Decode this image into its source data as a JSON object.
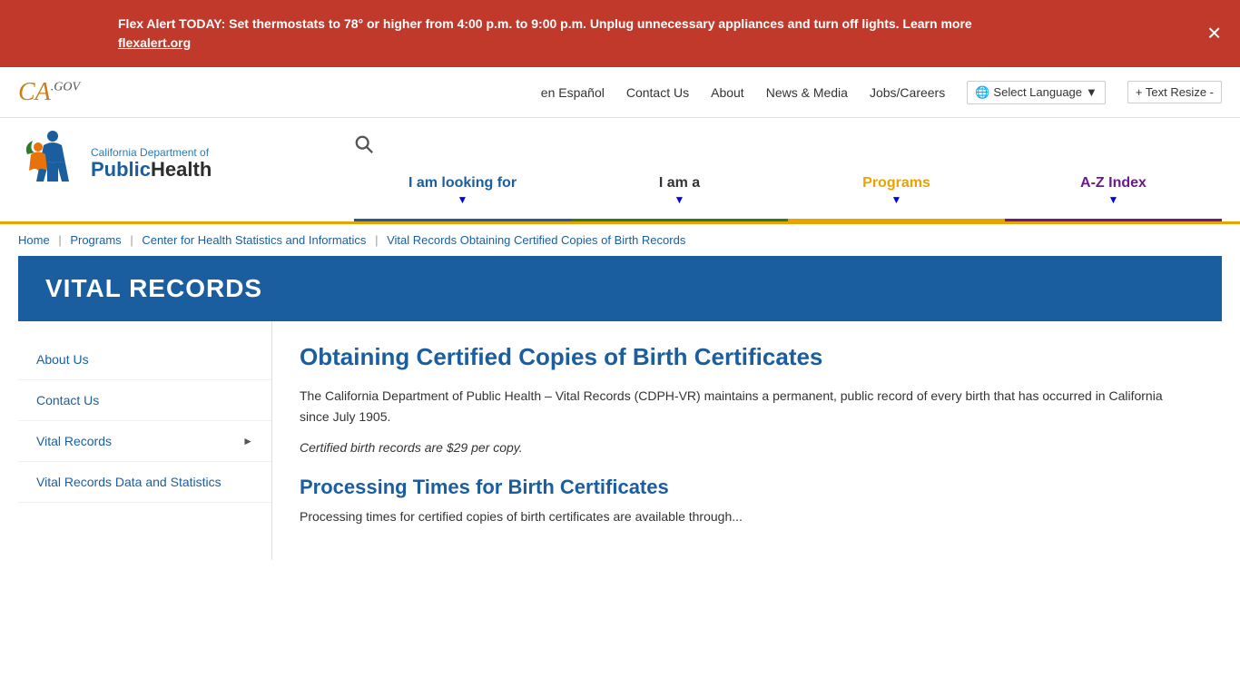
{
  "alert": {
    "text": "Flex Alert TODAY: Set thermostats to 78° or higher from 4:00 p.m. to 9:00 p.m. Unplug unnecessary appliances and turn off lights. Learn more",
    "link_text": "flexalert.org",
    "link_href": "#"
  },
  "topnav": {
    "logo": "CA",
    "logo_sup": ".GOV",
    "links": [
      {
        "label": "en Español",
        "href": "#"
      },
      {
        "label": "Contact Us",
        "href": "#"
      },
      {
        "label": "About",
        "href": "#"
      },
      {
        "label": "News & Media",
        "href": "#"
      },
      {
        "label": "Jobs/Careers",
        "href": "#"
      }
    ],
    "language_label": "Select Language",
    "text_resize_label": "+ Text Resize -"
  },
  "header": {
    "logo_line1": "California Department of",
    "logo_public": "Public",
    "logo_health": "Health",
    "nav_items": [
      {
        "label": "I am looking for",
        "style": "looking"
      },
      {
        "label": "I am a",
        "style": "iam"
      },
      {
        "label": "Programs",
        "style": "programs"
      },
      {
        "label": "A-Z Index",
        "style": "az"
      }
    ]
  },
  "breadcrumb": {
    "items": [
      {
        "label": "Home",
        "href": "#"
      },
      {
        "label": "Programs",
        "href": "#"
      },
      {
        "label": "Center for Health Statistics and Informatics",
        "href": "#"
      },
      {
        "label": "Vital Records Obtaining Certified Copies of Birth Records",
        "href": "#",
        "current": true
      }
    ]
  },
  "page_title": "VITAL RECORDS",
  "sidebar": {
    "items": [
      {
        "label": "About Us",
        "has_arrow": false
      },
      {
        "label": "Contact Us",
        "has_arrow": false
      },
      {
        "label": "Vital Records",
        "has_arrow": true
      },
      {
        "label": "Vital Records Data and Statistics",
        "has_arrow": false
      }
    ]
  },
  "content": {
    "title": "Obtaining Certified Copies of Birth Certificates",
    "paragraph1": "The California Department of Public Health – Vital Records (CDPH-VR) maintains a permanent, public record of every birth that has occurred in California since July 1905.",
    "paragraph2": "Certified birth records are $29 per copy.",
    "section_title": "Processing Times for Birth Certificates",
    "section_text": "Processing times for certified copies of birth certificates are available through..."
  }
}
